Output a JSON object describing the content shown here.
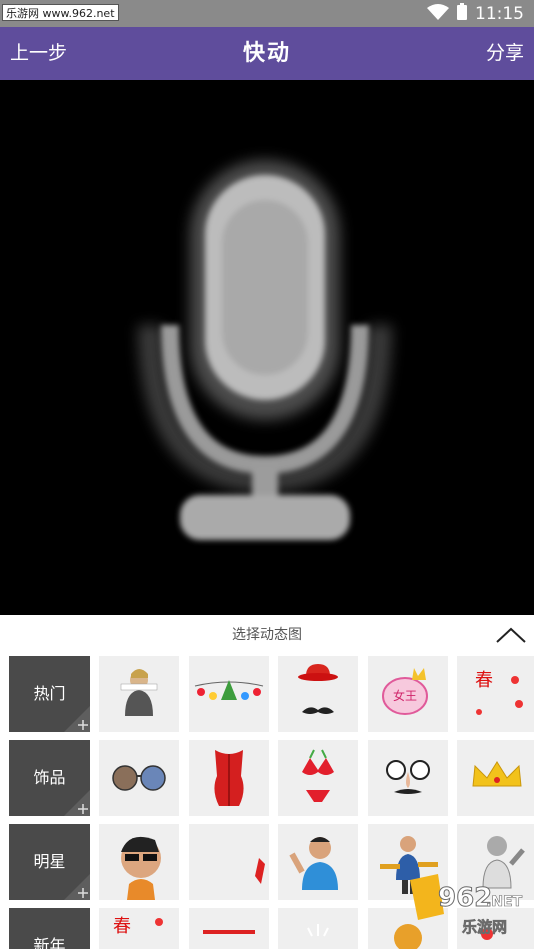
{
  "status_bar": {
    "watermark": "乐游网 www.962.net",
    "time": "11:15"
  },
  "top_bar": {
    "back_label": "上一步",
    "title": "快动",
    "share_label": "分享"
  },
  "panel": {
    "title": "选择动态图",
    "categories": [
      {
        "label": "热门",
        "stickers": [
          "hot-1",
          "hot-2",
          "hot-3",
          "hot-4",
          "hot-5"
        ]
      },
      {
        "label": "饰品",
        "stickers": [
          "acc-1",
          "acc-2",
          "acc-3",
          "acc-4",
          "acc-5"
        ]
      },
      {
        "label": "明星",
        "stickers": [
          "star-1",
          "star-2",
          "star-3",
          "star-4",
          "star-5"
        ]
      },
      {
        "label": "新年",
        "stickers": [
          "ny-1",
          "ny-2",
          "ny-3",
          "ny-4",
          "ny-5"
        ]
      }
    ]
  },
  "logo": {
    "number": "962",
    "suffix": ".NET",
    "caption": "乐游网"
  },
  "colors": {
    "accent": "#5f4d9c",
    "status_bar": "#8a8a8a",
    "category_bg": "#4a4a4a",
    "sticker_bg": "#efefef"
  }
}
